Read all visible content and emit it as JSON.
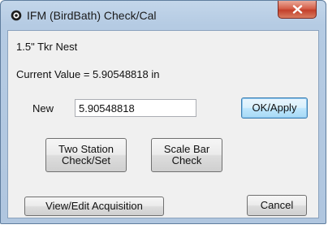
{
  "window": {
    "title": "IFM (BirdBath) Check/Cal",
    "close_symbol": "x"
  },
  "content": {
    "nest_label": "1.5\" Tkr Nest",
    "current_value_text": "Current Value = 5.90548818 in",
    "new_label": "New",
    "new_value": "5.90548818"
  },
  "buttons": {
    "ok_apply": "OK/Apply",
    "two_station": "Two Station\nCheck/Set",
    "scale_bar": "Scale Bar\nCheck",
    "view_edit_acquisition": "View/Edit Acquisition",
    "cancel": "Cancel"
  },
  "icons": {
    "app": "target-app-icon",
    "close": "close-icon"
  },
  "colors": {
    "title_frame": "#b5cbe3",
    "close_red": "#c3402b",
    "default_button_border": "#3c7fb1"
  }
}
